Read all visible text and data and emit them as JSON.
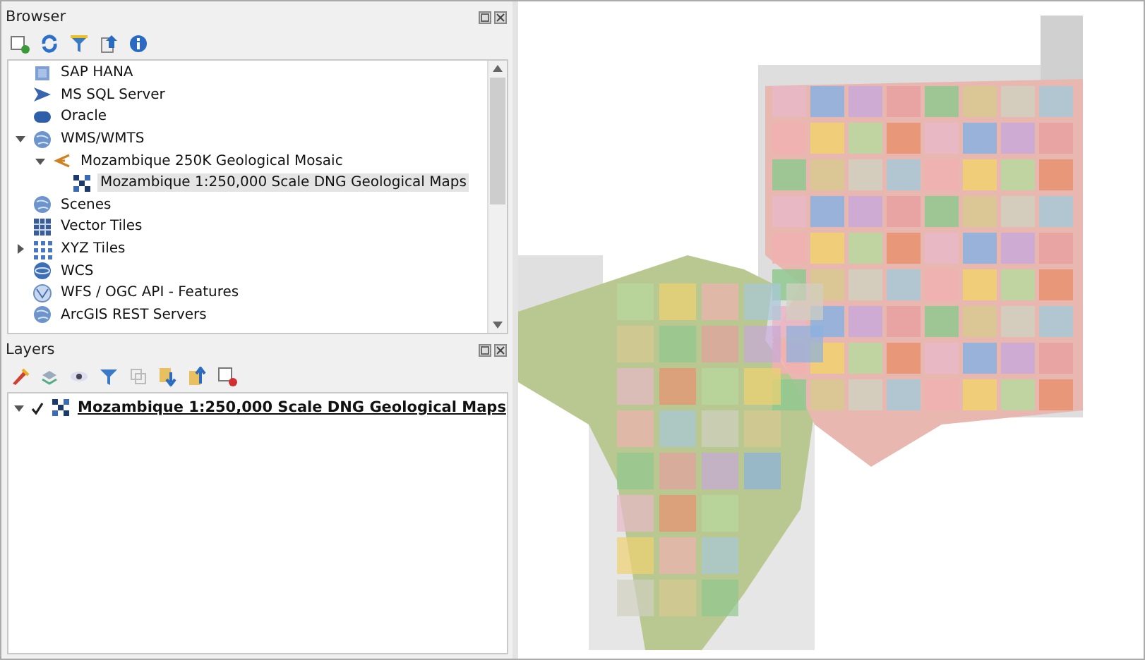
{
  "browser_panel": {
    "title": "Browser",
    "items": [
      {
        "label": "SAP HANA",
        "kind": "database",
        "selected": false
      },
      {
        "label": "MS SQL Server",
        "kind": "server",
        "selected": false
      },
      {
        "label": "Oracle",
        "kind": "oracle",
        "selected": false
      },
      {
        "label": "WMS/WMTS",
        "kind": "globe",
        "selected": false,
        "expanded": true,
        "children": [
          {
            "label": "Mozambique 250K Geological Mosaic",
            "kind": "connection",
            "selected": false,
            "expanded": true,
            "children": [
              {
                "label": "Mozambique 1:250,000 Scale DNG Geological Maps",
                "kind": "raster",
                "selected": true
              }
            ]
          }
        ]
      },
      {
        "label": "Scenes",
        "kind": "globe",
        "selected": false
      },
      {
        "label": "Vector Tiles",
        "kind": "grid",
        "selected": false
      },
      {
        "label": "XYZ Tiles",
        "kind": "dots",
        "selected": false,
        "expanded": false
      },
      {
        "label": "WCS",
        "kind": "wcs",
        "selected": false
      },
      {
        "label": "WFS / OGC API - Features",
        "kind": "wfs",
        "selected": false
      },
      {
        "label": "ArcGIS REST Servers",
        "kind": "globe",
        "selected": false
      }
    ]
  },
  "layers_panel": {
    "title": "Layers",
    "layers": [
      {
        "label": "Mozambique 1:250,000 Scale DNG Geological Maps",
        "checked": true,
        "expanded": true
      }
    ]
  }
}
